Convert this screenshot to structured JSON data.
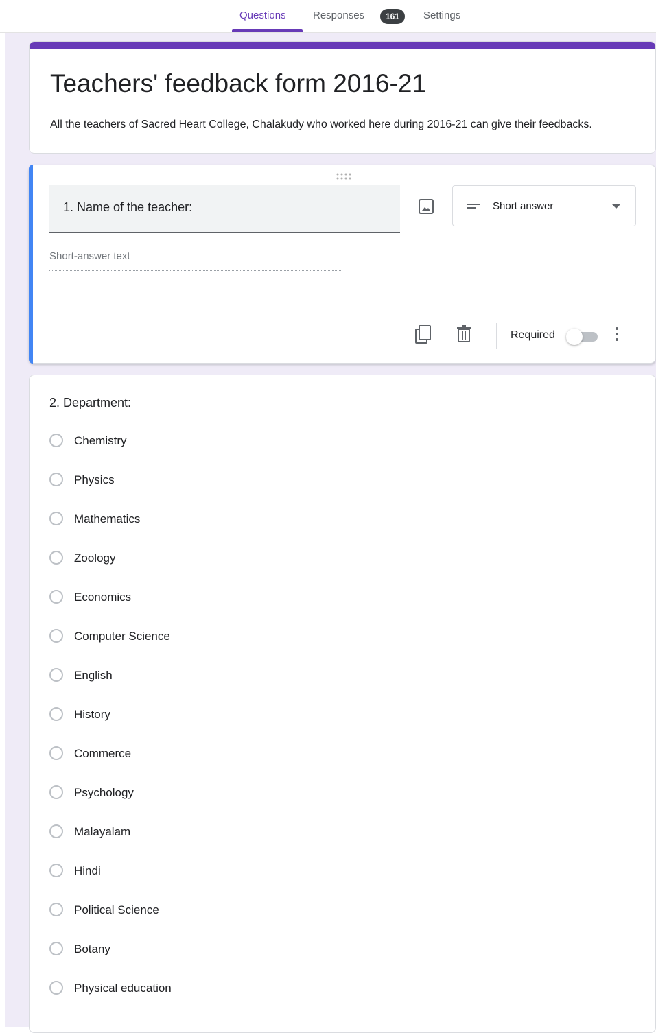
{
  "tabs": {
    "questions": "Questions",
    "responses": "Responses",
    "responses_count": "161",
    "settings": "Settings",
    "active": "Questions"
  },
  "colors": {
    "accent": "#673ab7",
    "active_question_bar": "#4285f4",
    "background": "#efebf7"
  },
  "form": {
    "title": "Teachers' feedback form 2016-21",
    "description": "All the teachers of Sacred Heart College, Chalakudy who worked here during 2016-21 can give their feedbacks."
  },
  "question1": {
    "title": "1. Name of the teacher:",
    "type": "Short answer",
    "type_icon": "short-text-icon",
    "answer_placeholder": "Short-answer text",
    "required_label": "Required",
    "required": false,
    "icons": [
      "drag-handle-icon",
      "add-image-icon",
      "duplicate-icon",
      "delete-icon",
      "more-vert-icon"
    ]
  },
  "question2": {
    "title": "2. Department:",
    "options": [
      "Chemistry",
      "Physics",
      "Mathematics",
      "Zoology",
      "Economics",
      "Computer Science",
      "English",
      "History",
      "Commerce",
      "Psychology",
      "Malayalam",
      "Hindi",
      "Political Science",
      "Botany",
      "Physical education"
    ]
  }
}
